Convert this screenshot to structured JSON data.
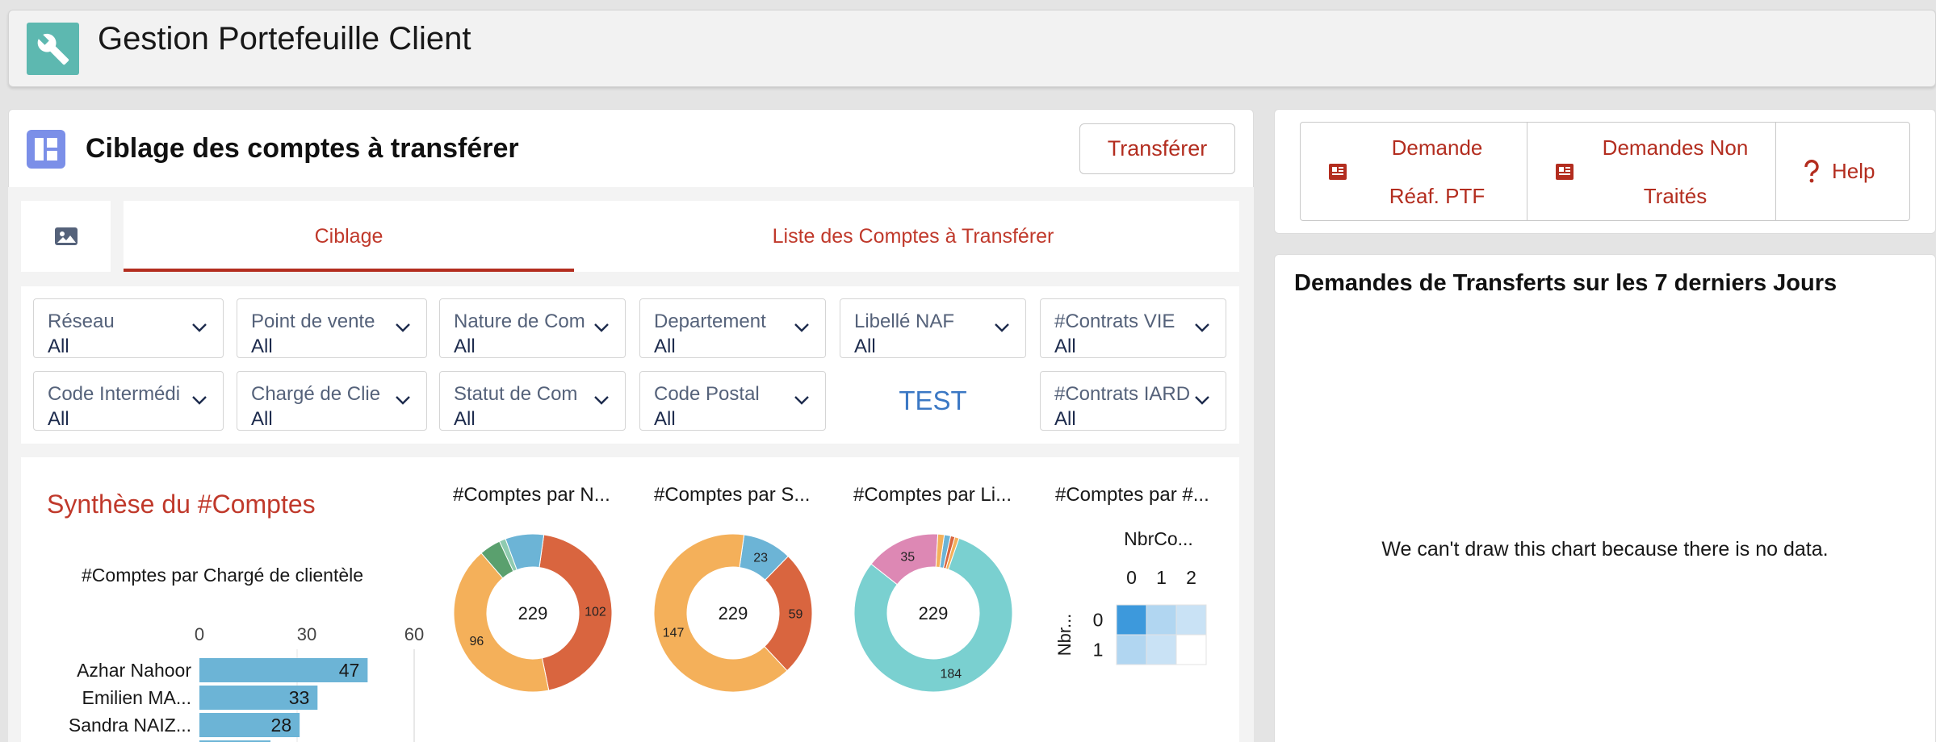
{
  "app": {
    "title": "Gestion Portefeuille Client"
  },
  "header": {
    "title": "Ciblage des comptes à transférer",
    "transfer_button": "Transférer"
  },
  "tabs": [
    {
      "label": "Ciblage",
      "active": true
    },
    {
      "label": "Liste des Comptes à Transférer",
      "active": false
    }
  ],
  "filters_row1": [
    {
      "label": "Réseau",
      "value": "All"
    },
    {
      "label": "Point de vente",
      "value": "All"
    },
    {
      "label": "Nature de Com",
      "value": "All"
    },
    {
      "label": "Departement",
      "value": "All"
    },
    {
      "label": "Libellé NAF",
      "value": "All"
    },
    {
      "label": "#Contrats VIE",
      "value": "All"
    }
  ],
  "filters_row2": [
    {
      "label": "Code Intermédi",
      "value": "All"
    },
    {
      "label": "Chargé de Clie",
      "value": "All"
    },
    {
      "label": "Statut de Com",
      "value": "All"
    },
    {
      "label": "Code Postal",
      "value": "All"
    },
    {
      "label": "TEST",
      "value": ""
    },
    {
      "label": "#Contrats IARD",
      "value": "All"
    }
  ],
  "synthese": {
    "title": "Synthèse du #Comptes"
  },
  "side_buttons": [
    {
      "line1": "Demande",
      "line2": "Réaf. PTF",
      "icon": "news-icon"
    },
    {
      "line1": "Demandes Non",
      "line2": "Traités",
      "icon": "news-icon"
    },
    {
      "line1": "Help",
      "line2": "",
      "icon": "question-icon"
    }
  ],
  "side_chart": {
    "title": "Demandes de Transferts sur les 7 derniers Jours",
    "message": "We can't draw this chart because there is no data."
  },
  "colors": {
    "accent": "#b32d1f",
    "app_icon": "#5db8b0",
    "bar": "#6cb4d6",
    "orange": "#f4b05a",
    "red": "#d9653f",
    "blue": "#6cb4d6",
    "green": "#5aa06e",
    "teal": "#7ad0d0",
    "pink": "#dd88b4"
  },
  "chart_data": [
    {
      "type": "bar",
      "title": "#Comptes par Chargé de clientèle",
      "orientation": "horizontal",
      "categories": [
        "Azhar Nahoor",
        "Emilien MA...",
        "Sandra NAIZ..."
      ],
      "values": [
        47,
        33,
        28
      ],
      "xlim": [
        0,
        60
      ],
      "xticks": [
        0,
        30,
        60
      ]
    },
    {
      "type": "pie",
      "title": "#Comptes par N...",
      "center_label": "229",
      "slices": [
        {
          "value": 102,
          "label": "102",
          "color": "#d9653f"
        },
        {
          "value": 96,
          "label": "96",
          "color": "#f4b05a"
        },
        {
          "value": 10,
          "label": "",
          "color": "#5aa06e"
        },
        {
          "value": 3,
          "label": "",
          "color": "#8fcbb0"
        },
        {
          "value": 18,
          "label": "",
          "color": "#6cb4d6"
        }
      ]
    },
    {
      "type": "pie",
      "title": "#Comptes par S...",
      "center_label": "229",
      "slices": [
        {
          "value": 23,
          "label": "23",
          "color": "#6cb4d6"
        },
        {
          "value": 59,
          "label": "59",
          "color": "#d9653f"
        },
        {
          "value": 147,
          "label": "147",
          "color": "#f4b05a"
        }
      ]
    },
    {
      "type": "pie",
      "title": "#Comptes par Li...",
      "center_label": "229",
      "slices": [
        {
          "value": 3,
          "label": "",
          "color": "#6cb4d6"
        },
        {
          "value": 2,
          "label": "",
          "color": "#d9653f"
        },
        {
          "value": 2,
          "label": "",
          "color": "#f4b05a"
        },
        {
          "value": 184,
          "label": "184",
          "color": "#7ad0d0"
        },
        {
          "value": 35,
          "label": "35",
          "color": "#dd88b4"
        },
        {
          "value": 3,
          "label": "",
          "color": "#f4b05a"
        }
      ]
    },
    {
      "type": "heatmap",
      "title": "#Comptes par #...",
      "xlabel": "NbrCo...",
      "ylabel": "Nbr...",
      "x": [
        "0",
        "1",
        "2"
      ],
      "y": [
        "0",
        "1"
      ],
      "cells": [
        [
          1.0,
          0.25,
          0.1
        ],
        [
          0.25,
          0.1,
          0.0
        ]
      ]
    }
  ]
}
